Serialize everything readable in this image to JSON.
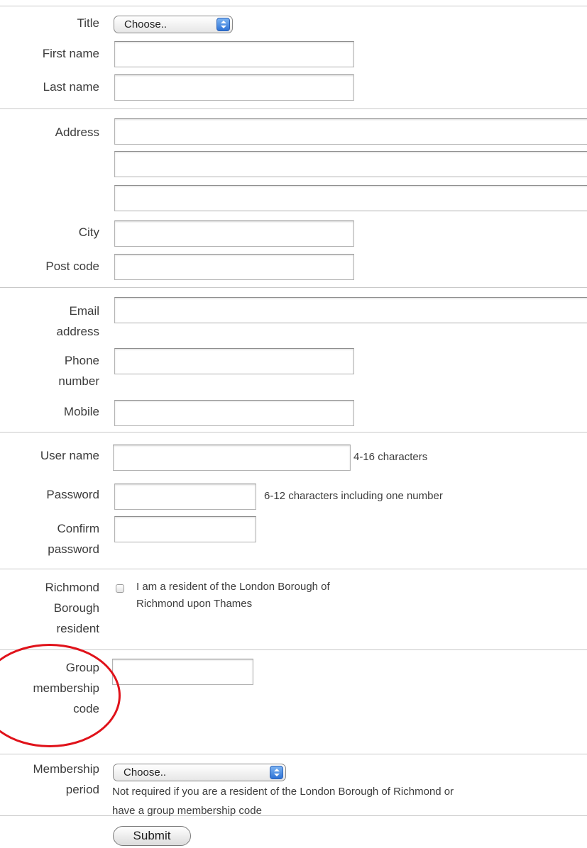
{
  "form": {
    "title": {
      "label": "Title",
      "select_value": "Choose.."
    },
    "first_name": {
      "label": "First name",
      "value": ""
    },
    "last_name": {
      "label": "Last name",
      "value": ""
    },
    "address": {
      "label": "Address",
      "line1": "",
      "line2": "",
      "line3": ""
    },
    "city": {
      "label": "City",
      "value": ""
    },
    "post_code": {
      "label": "Post code",
      "value": ""
    },
    "email": {
      "label_line1": "Email",
      "label_line2": "address",
      "value": ""
    },
    "phone": {
      "label_line1": "Phone",
      "label_line2": "number",
      "value": ""
    },
    "mobile": {
      "label": "Mobile",
      "value": ""
    },
    "user_name": {
      "label": "User name",
      "value": "",
      "hint": "4-16 characters"
    },
    "password": {
      "label": "Password",
      "value": "",
      "hint": "6-12 characters including one number"
    },
    "confirm_password": {
      "label_line1": "Confirm",
      "label_line2": "password",
      "value": ""
    },
    "resident": {
      "label_line1": "Richmond",
      "label_line2": "Borough",
      "label_line3": "resident",
      "checked": false,
      "checkbox_text_line1": "I am a resident of the London Borough of",
      "checkbox_text_line2": "Richmond upon Thames"
    },
    "group_code": {
      "label_line1": "Group",
      "label_line2": "membership",
      "label_line3": "code",
      "value": ""
    },
    "membership_period": {
      "label_line1": "Membership",
      "label_line2": "period",
      "select_value": "Choose..",
      "note_line1": "Not required if you are a resident of the London Borough of Richmond or",
      "note_line2": "have a group membership code"
    },
    "submit_label": "Submit"
  },
  "colors": {
    "highlight_ring": "#e0121a",
    "select_cap": "#2e73d6",
    "rule": "#c9c9c9"
  }
}
